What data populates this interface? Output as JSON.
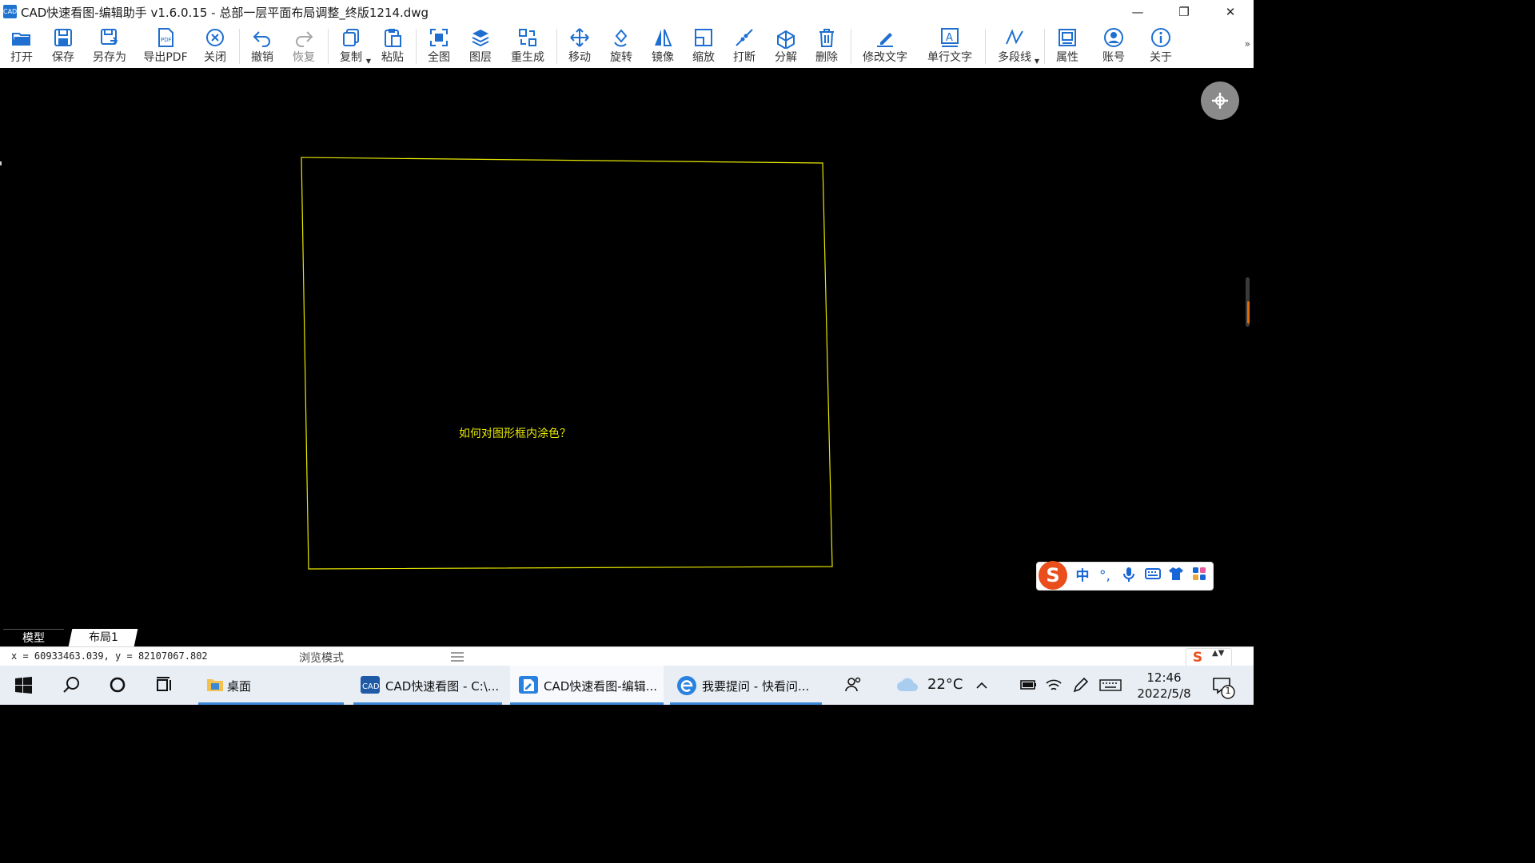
{
  "window": {
    "app_icon_text": "CAD",
    "title": "CAD快速看图-编辑助手 v1.6.0.15 - 总部一层平面布局调整_终版1214.dwg",
    "controls": {
      "minimize": "—",
      "restore": "❐",
      "close": "✕"
    }
  },
  "toolbar": {
    "items": [
      {
        "label": "打开",
        "icon": "open-folder-icon"
      },
      {
        "label": "保存",
        "icon": "save-icon"
      },
      {
        "label": "另存为",
        "icon": "save-as-icon"
      },
      {
        "label": "导出PDF",
        "icon": "pdf-export-icon"
      },
      {
        "label": "关闭",
        "icon": "close-circle-icon"
      },
      {
        "label": "撤销",
        "icon": "undo-icon"
      },
      {
        "label": "恢复",
        "icon": "redo-icon",
        "disabled": true
      },
      {
        "label": "复制",
        "icon": "copy-icon",
        "dropdown": true
      },
      {
        "label": "粘贴",
        "icon": "paste-icon"
      },
      {
        "label": "全图",
        "icon": "full-view-icon"
      },
      {
        "label": "图层",
        "icon": "layers-icon"
      },
      {
        "label": "重生成",
        "icon": "regenerate-icon"
      },
      {
        "label": "移动",
        "icon": "move-icon"
      },
      {
        "label": "旋转",
        "icon": "rotate-icon"
      },
      {
        "label": "镜像",
        "icon": "mirror-icon"
      },
      {
        "label": "缩放",
        "icon": "scale-icon"
      },
      {
        "label": "打断",
        "icon": "break-icon"
      },
      {
        "label": "分解",
        "icon": "explode-icon"
      },
      {
        "label": "删除",
        "icon": "delete-icon"
      },
      {
        "label": "修改文字",
        "icon": "edit-text-icon"
      },
      {
        "label": "单行文字",
        "icon": "single-line-text-icon"
      },
      {
        "label": "多段线",
        "icon": "polyline-icon",
        "dropdown": true
      },
      {
        "label": "属性",
        "icon": "properties-icon"
      },
      {
        "label": "账号",
        "icon": "account-icon"
      },
      {
        "label": "关于",
        "icon": "about-icon"
      }
    ],
    "more": "»"
  },
  "drawing": {
    "text": "如何对图形框内涂色？",
    "line_color": "#e8e800",
    "background": "#000000"
  },
  "ime": {
    "logo": "S",
    "mode": "中",
    "punct": "°,",
    "icons": [
      "microphone-icon",
      "keyboard-icon",
      "skin-icon",
      "toolbox-icon"
    ]
  },
  "tabs": [
    "模型",
    "布局1"
  ],
  "status": {
    "coords": "x = 60933463.039,  y = 82107067.802",
    "mode": "浏览模式",
    "ime_logo": "S",
    "ime_arrows": "▲▼"
  },
  "taskbar": {
    "apps": [
      {
        "label": "桌面",
        "icon": "folder-icon"
      },
      {
        "label": "CAD快速看图 - C:\\...",
        "icon": "cad-viewer-icon"
      },
      {
        "label": "CAD快速看图-编辑...",
        "icon": "cad-editor-icon",
        "active": true
      },
      {
        "label": "我要提问 - 快看问...",
        "icon": "browser-icon"
      }
    ],
    "weather": "22°C",
    "time": "12:46",
    "date": "2022/5/8",
    "notification_count": "1"
  }
}
